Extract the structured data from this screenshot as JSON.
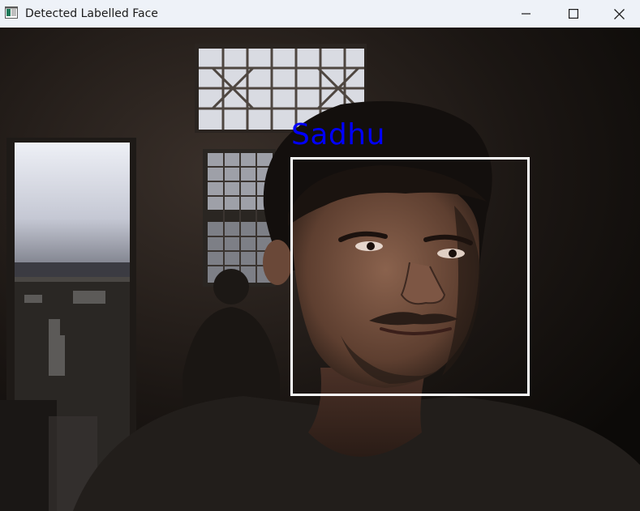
{
  "window": {
    "title": "Detected Labelled Face",
    "controls": {
      "minimize": "minimize",
      "maximize": "maximize",
      "close": "close"
    }
  },
  "detection": {
    "label": "Sadhu",
    "label_color": "#0000ff",
    "box_color": "#ffffff"
  }
}
